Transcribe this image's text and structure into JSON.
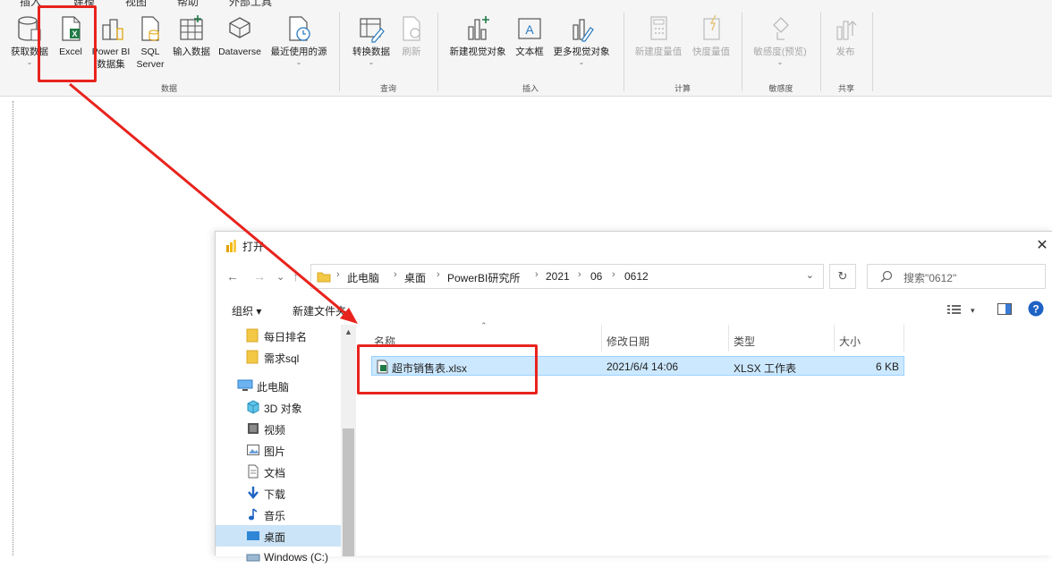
{
  "ribbon": {
    "tabs": [
      "插入",
      "建模",
      "视图",
      "帮助",
      "外部工具"
    ],
    "groups": [
      {
        "label": "数据"
      },
      {
        "label": "查询"
      },
      {
        "label": "插入"
      },
      {
        "label": "计算"
      },
      {
        "label": "敏感度"
      },
      {
        "label": "共享"
      }
    ],
    "buttons": {
      "get_data": [
        "获取数据"
      ],
      "excel": [
        "Excel"
      ],
      "powerbi": [
        "Power BI",
        "数据集"
      ],
      "sql": [
        "SQL",
        "Server"
      ],
      "enter_data": [
        "输入数据"
      ],
      "dataverse": [
        "Dataverse"
      ],
      "recent": [
        "最近使用的源"
      ],
      "transform": [
        "转换数据"
      ],
      "refresh": [
        "刷新"
      ],
      "new_visual": [
        "新建视觉对象"
      ],
      "textbox": [
        "文本框"
      ],
      "more_visuals": [
        "更多视觉对象"
      ],
      "new_measure": [
        "新建度量值"
      ],
      "quick_measure": [
        "快度量值"
      ],
      "sensitivity": [
        "敏感度(预览)"
      ],
      "publish": [
        "发布"
      ]
    }
  },
  "dialog": {
    "title": "打开",
    "close": "✕",
    "nav": {
      "back": "←",
      "forward": "→",
      "down": "⌄",
      "up": "↑"
    },
    "breadcrumb": [
      "此电脑",
      "桌面",
      "PowerBI研究所",
      "2021",
      "06",
      "0612"
    ],
    "search_placeholder": "搜索\"0612\"",
    "toolbar": {
      "organize": "组织 ▾",
      "new_folder": "新建文件夹"
    },
    "nav_pane": [
      {
        "label": "每日排名",
        "icon": "folder-icon"
      },
      {
        "label": "需求sql",
        "icon": "folder-icon"
      },
      {
        "label": "此电脑",
        "icon": "computer-icon"
      },
      {
        "label": "3D 对象",
        "icon": "cube-icon"
      },
      {
        "label": "视频",
        "icon": "video-icon"
      },
      {
        "label": "图片",
        "icon": "picture-icon"
      },
      {
        "label": "文档",
        "icon": "document-icon"
      },
      {
        "label": "下载",
        "icon": "download-icon"
      },
      {
        "label": "音乐",
        "icon": "music-icon"
      },
      {
        "label": "桌面",
        "icon": "desktop-icon"
      },
      {
        "label": "Windows (C:)",
        "icon": "drive-icon"
      }
    ],
    "columns": [
      "名称",
      "修改日期",
      "类型",
      "大小"
    ],
    "files": [
      {
        "name": "超市销售表.xlsx",
        "modified": "2021/6/4 14:06",
        "type": "XLSX 工作表",
        "size": "6 KB"
      }
    ]
  },
  "colors": {
    "highlight": "#e8231d",
    "selected_row": "#cce8ff",
    "excel_green": "#1f7a45"
  }
}
